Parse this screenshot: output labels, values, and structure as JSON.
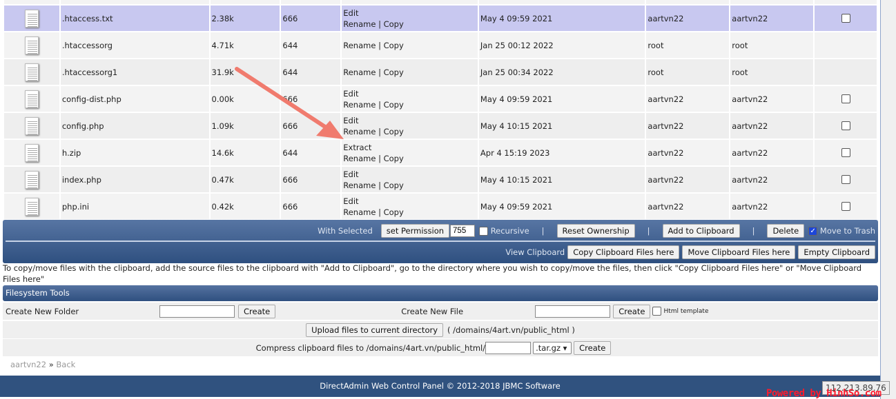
{
  "files": [
    {
      "name": "",
      "size": "",
      "perm": "",
      "actions": [],
      "date": "",
      "owner": "",
      "group": "",
      "checkbox": false,
      "partial": true
    },
    {
      "name": ".htaccess.txt",
      "size": "2.38k",
      "perm": "666",
      "edit": "Edit",
      "date": "May 4 09:59 2021",
      "owner": "aartvn22",
      "group": "aartvn22",
      "checkbox": true,
      "selected": true
    },
    {
      "name": ".htaccessorg",
      "size": "4.71k",
      "perm": "644",
      "edit": "",
      "date": "Jan 25 00:12 2022",
      "owner": "root",
      "group": "root",
      "checkbox": false
    },
    {
      "name": ".htaccessorg1",
      "size": "31.9k",
      "perm": "644",
      "edit": "",
      "date": "Jan 25 00:34 2022",
      "owner": "root",
      "group": "root",
      "checkbox": false
    },
    {
      "name": "config-dist.php",
      "size": "0.00k",
      "perm": "666",
      "edit": "Edit",
      "date": "May 4 09:59 2021",
      "owner": "aartvn22",
      "group": "aartvn22",
      "checkbox": true
    },
    {
      "name": "config.php",
      "size": "1.09k",
      "perm": "666",
      "edit": "Edit",
      "date": "May 4 10:15 2021",
      "owner": "aartvn22",
      "group": "aartvn22",
      "checkbox": true
    },
    {
      "name": "h.zip",
      "size": "14.6k",
      "perm": "644",
      "edit": "Extract",
      "date": "Apr 4 15:19 2023",
      "owner": "aartvn22",
      "group": "aartvn22",
      "checkbox": true
    },
    {
      "name": "index.php",
      "size": "0.47k",
      "perm": "666",
      "edit": "Edit",
      "date": "May 4 10:15 2021",
      "owner": "aartvn22",
      "group": "aartvn22",
      "checkbox": true
    },
    {
      "name": "php.ini",
      "size": "0.42k",
      "perm": "666",
      "edit": "Edit",
      "date": "May 4 09:59 2021",
      "owner": "aartvn22",
      "group": "aartvn22",
      "checkbox": true
    }
  ],
  "actions": {
    "rename": "Rename",
    "copy": "Copy",
    "sep": "|"
  },
  "toolbar": {
    "with_selected": "With Selected",
    "set_permission": "set Permission",
    "permission_value": "755",
    "recursive": "Recursive",
    "reset_ownership": "Reset Ownership",
    "add_to_clipboard": "Add to Clipboard",
    "delete": "Delete",
    "move_to_trash": "Move to Trash",
    "sep": "|",
    "view_clipboard": "View Clipboard",
    "copy_clipboard": "Copy Clipboard Files here",
    "move_clipboard": "Move Clipboard Files here",
    "empty_clipboard": "Empty Clipboard"
  },
  "note": "To copy/move files with the clipboard, add the source files to the clipboard with \"Add to Clipboard\", go to the directory where you wish to copy/move the files, then click \"Copy Clipboard Files here\" or \"Move Clipboard Files here\"",
  "fs": {
    "title": "Filesystem Tools",
    "new_folder": "Create New Folder",
    "new_file": "Create New File",
    "create": "Create",
    "html_template": "Html template",
    "upload": "Upload files to current directory",
    "upload_path": "( /domains/4art.vn/public_html )",
    "compress": "Compress clipboard files to /domains/4art.vn/public_html/",
    "compress_ext": ".tar.gz"
  },
  "breadcrumb": {
    "user": "aartvn22",
    "sep": "»",
    "back": "Back"
  },
  "footer": "DirectAdmin Web Control Panel © 2012-2018 JBMC Software",
  "ip": "112.213.89.76",
  "watermark": "Powered by HinhSo.com",
  "colors": {
    "selected_row": "#c8c8f0",
    "header_blue": "#30527f",
    "arrow": "#f07b6e"
  }
}
